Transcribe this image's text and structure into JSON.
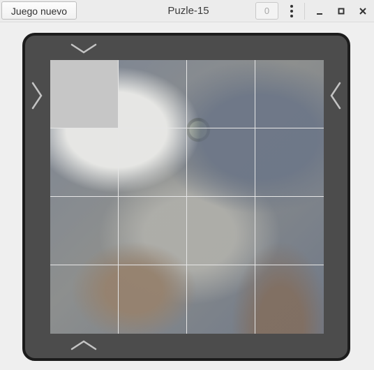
{
  "header": {
    "new_game_label": "Juego nuevo",
    "title": "Puzle-15",
    "moves": "0"
  },
  "board": {
    "size": 4,
    "tiles": [
      {
        "id": "blank",
        "blank": true
      },
      {
        "id": "t1",
        "blank": false
      },
      {
        "id": "t2",
        "blank": false
      },
      {
        "id": "t3",
        "blank": false
      },
      {
        "id": "t4",
        "blank": false
      },
      {
        "id": "t5",
        "blank": false
      },
      {
        "id": "t6",
        "blank": false
      },
      {
        "id": "t7",
        "blank": false
      },
      {
        "id": "t8",
        "blank": false
      },
      {
        "id": "t9",
        "blank": false
      },
      {
        "id": "t10",
        "blank": false
      },
      {
        "id": "t11",
        "blank": false
      },
      {
        "id": "t12",
        "blank": false
      },
      {
        "id": "t13",
        "blank": false
      },
      {
        "id": "t14",
        "blank": false
      },
      {
        "id": "t15",
        "blank": false
      }
    ],
    "image": "cat-photo"
  },
  "colors": {
    "frame": "#4c4c4c",
    "frame_border": "#1c1c1c",
    "blank_tile": "#c6c6c6",
    "arrow": "#c4c4c4"
  },
  "icons": [
    "menu-icon",
    "minimize-icon",
    "maximize-icon",
    "close-icon",
    "arrow-up-icon",
    "arrow-down-icon",
    "arrow-left-icon",
    "arrow-right-icon"
  ]
}
